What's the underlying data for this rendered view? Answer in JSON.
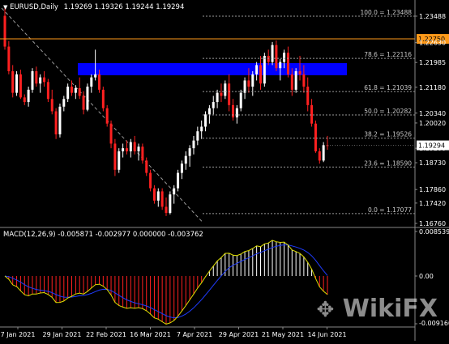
{
  "header": {
    "symbol": "EURUSD,Daily",
    "ohlc": "1.19269 1.19326 1.19244 1.19294",
    "dropdown_icon": "triangle-down-icon"
  },
  "price_axis": {
    "ticks": [
      "1.23488",
      "1.22630",
      "1.21985",
      "1.21180",
      "1.20340",
      "1.20020",
      "1.19200",
      "1.18730",
      "1.17860",
      "1.17420",
      "1.16760"
    ],
    "current_label": "1.19294",
    "hline_label": "1.22750"
  },
  "fib_levels": [
    {
      "label": "100.0 = 1.23488"
    },
    {
      "label": "78.6 = 1.22116"
    },
    {
      "label": "61.8 = 1.21039"
    },
    {
      "label": "50.0 = 1.20282"
    },
    {
      "label": "38.2 = 1.19526"
    },
    {
      "label": "23.6 = 1.18590"
    },
    {
      "label": "0.0 = 1.17077"
    }
  ],
  "macd": {
    "label": "MACD(12,26,9) -0.005871 -0.002977 0.000000 -0.003762",
    "axis_top": "0.008539",
    "axis_zero": "0.00",
    "axis_bottom": "-0.009160"
  },
  "time_axis": [
    "7 Jan 2021",
    "29 Jan 2021",
    "22 Feb 2021",
    "16 Mar 2021",
    "7 Apr 2021",
    "29 Apr 2021",
    "21 May 2021",
    "14 Jun 2021"
  ],
  "watermark": "WikiFX",
  "colors": {
    "bull": "#ffffff",
    "bear": "#ff2020",
    "zone": "#0000ff",
    "hline": "#ff9a1a",
    "macd_line": "#e0e000",
    "signal_line": "#1f3cff"
  },
  "chart_data": {
    "type": "candlestick",
    "symbol": "EURUSD",
    "timeframe": "Daily",
    "ylim": [
      1.1676,
      1.2375
    ],
    "candles": [
      [
        1.235,
        1.2375,
        1.224,
        1.225
      ],
      [
        1.225,
        1.2268,
        1.216,
        1.217
      ],
      [
        1.217,
        1.219,
        1.2085,
        1.21
      ],
      [
        1.21,
        1.217,
        1.209,
        1.216
      ],
      [
        1.216,
        1.2175,
        1.208,
        1.2085
      ],
      [
        1.2085,
        1.2095,
        1.206,
        1.207
      ],
      [
        1.207,
        1.212,
        1.2055,
        1.211
      ],
      [
        1.211,
        1.218,
        1.21,
        1.217
      ],
      [
        1.217,
        1.2185,
        1.212,
        1.213
      ],
      [
        1.213,
        1.216,
        1.21,
        1.215
      ],
      [
        1.215,
        1.217,
        1.212,
        1.2135
      ],
      [
        1.2135,
        1.2145,
        1.207,
        1.208
      ],
      [
        1.208,
        1.211,
        1.203,
        1.204
      ],
      [
        1.204,
        1.205,
        1.195,
        1.1965
      ],
      [
        1.1965,
        1.2065,
        1.1955,
        1.2055
      ],
      [
        1.2055,
        1.209,
        1.204,
        1.208
      ],
      [
        1.208,
        1.213,
        1.207,
        1.212
      ],
      [
        1.212,
        1.214,
        1.209,
        1.21
      ],
      [
        1.21,
        1.2125,
        1.208,
        1.2115
      ],
      [
        1.2115,
        1.215,
        1.208,
        1.209
      ],
      [
        1.209,
        1.2105,
        1.203,
        1.2045
      ],
      [
        1.2045,
        1.213,
        1.204,
        1.212
      ],
      [
        1.212,
        1.216,
        1.21,
        1.215
      ],
      [
        1.215,
        1.224,
        1.214,
        1.216
      ],
      [
        1.216,
        1.2175,
        1.21,
        1.211
      ],
      [
        1.211,
        1.212,
        1.204,
        1.205
      ],
      [
        1.205,
        1.206,
        1.199,
        1.2
      ],
      [
        1.2,
        1.201,
        1.192,
        1.1935
      ],
      [
        1.1935,
        1.195,
        1.183,
        1.185
      ],
      [
        1.185,
        1.192,
        1.184,
        1.191
      ],
      [
        1.191,
        1.1935,
        1.189,
        1.192
      ],
      [
        1.192,
        1.1945,
        1.19,
        1.191
      ],
      [
        1.191,
        1.195,
        1.189,
        1.194
      ],
      [
        1.194,
        1.196,
        1.19,
        1.191
      ],
      [
        1.191,
        1.1935,
        1.188,
        1.1925
      ],
      [
        1.1925,
        1.1935,
        1.187,
        1.188
      ],
      [
        1.188,
        1.189,
        1.183,
        1.184
      ],
      [
        1.184,
        1.185,
        1.178,
        1.179
      ],
      [
        1.179,
        1.18,
        1.174,
        1.175
      ],
      [
        1.175,
        1.179,
        1.173,
        1.178
      ],
      [
        1.178,
        1.179,
        1.172,
        1.173
      ],
      [
        1.173,
        1.176,
        1.17,
        1.171
      ],
      [
        1.171,
        1.178,
        1.1705,
        1.177
      ],
      [
        1.177,
        1.18,
        1.174,
        1.179
      ],
      [
        1.179,
        1.185,
        1.178,
        1.184
      ],
      [
        1.184,
        1.188,
        1.182,
        1.187
      ],
      [
        1.187,
        1.191,
        1.185,
        1.1895
      ],
      [
        1.1895,
        1.193,
        1.186,
        1.192
      ],
      [
        1.192,
        1.196,
        1.19,
        1.1945
      ],
      [
        1.1945,
        1.199,
        1.193,
        1.1975
      ],
      [
        1.1975,
        1.201,
        1.195,
        1.199
      ],
      [
        1.199,
        1.204,
        1.1975,
        1.203
      ],
      [
        1.203,
        1.206,
        1.2,
        1.205
      ],
      [
        1.205,
        1.209,
        1.203,
        1.207
      ],
      [
        1.207,
        1.211,
        1.205,
        1.21
      ],
      [
        1.21,
        1.213,
        1.207,
        1.209
      ],
      [
        1.209,
        1.214,
        1.208,
        1.213
      ],
      [
        1.213,
        1.216,
        1.204,
        1.206
      ],
      [
        1.206,
        1.208,
        1.201,
        1.202
      ],
      [
        1.202,
        1.206,
        1.2,
        1.205
      ],
      [
        1.205,
        1.211,
        1.204,
        1.21
      ],
      [
        1.21,
        1.215,
        1.208,
        1.214
      ],
      [
        1.214,
        1.218,
        1.21,
        1.212
      ],
      [
        1.212,
        1.217,
        1.209,
        1.216
      ],
      [
        1.216,
        1.22,
        1.214,
        1.219
      ],
      [
        1.219,
        1.222,
        1.211,
        1.213
      ],
      [
        1.213,
        1.223,
        1.212,
        1.222
      ],
      [
        1.222,
        1.224,
        1.219,
        1.22
      ],
      [
        1.22,
        1.2265,
        1.219,
        1.2255
      ],
      [
        1.2255,
        1.227,
        1.217,
        1.218
      ],
      [
        1.218,
        1.221,
        1.214,
        1.22
      ],
      [
        1.22,
        1.224,
        1.218,
        1.223
      ],
      [
        1.223,
        1.225,
        1.215,
        1.216
      ],
      [
        1.216,
        1.218,
        1.209,
        1.211
      ],
      [
        1.211,
        1.218,
        1.21,
        1.217
      ],
      [
        1.217,
        1.222,
        1.214,
        1.216
      ],
      [
        1.216,
        1.219,
        1.21,
        1.212
      ],
      [
        1.212,
        1.215,
        1.204,
        1.206
      ],
      [
        1.206,
        1.208,
        1.199,
        1.2
      ],
      [
        1.2,
        1.201,
        1.1905,
        1.191
      ],
      [
        1.191,
        1.192,
        1.187,
        1.188
      ],
      [
        1.188,
        1.194,
        1.1875,
        1.193
      ],
      [
        1.193,
        1.196,
        1.1915,
        1.1929
      ]
    ]
  }
}
